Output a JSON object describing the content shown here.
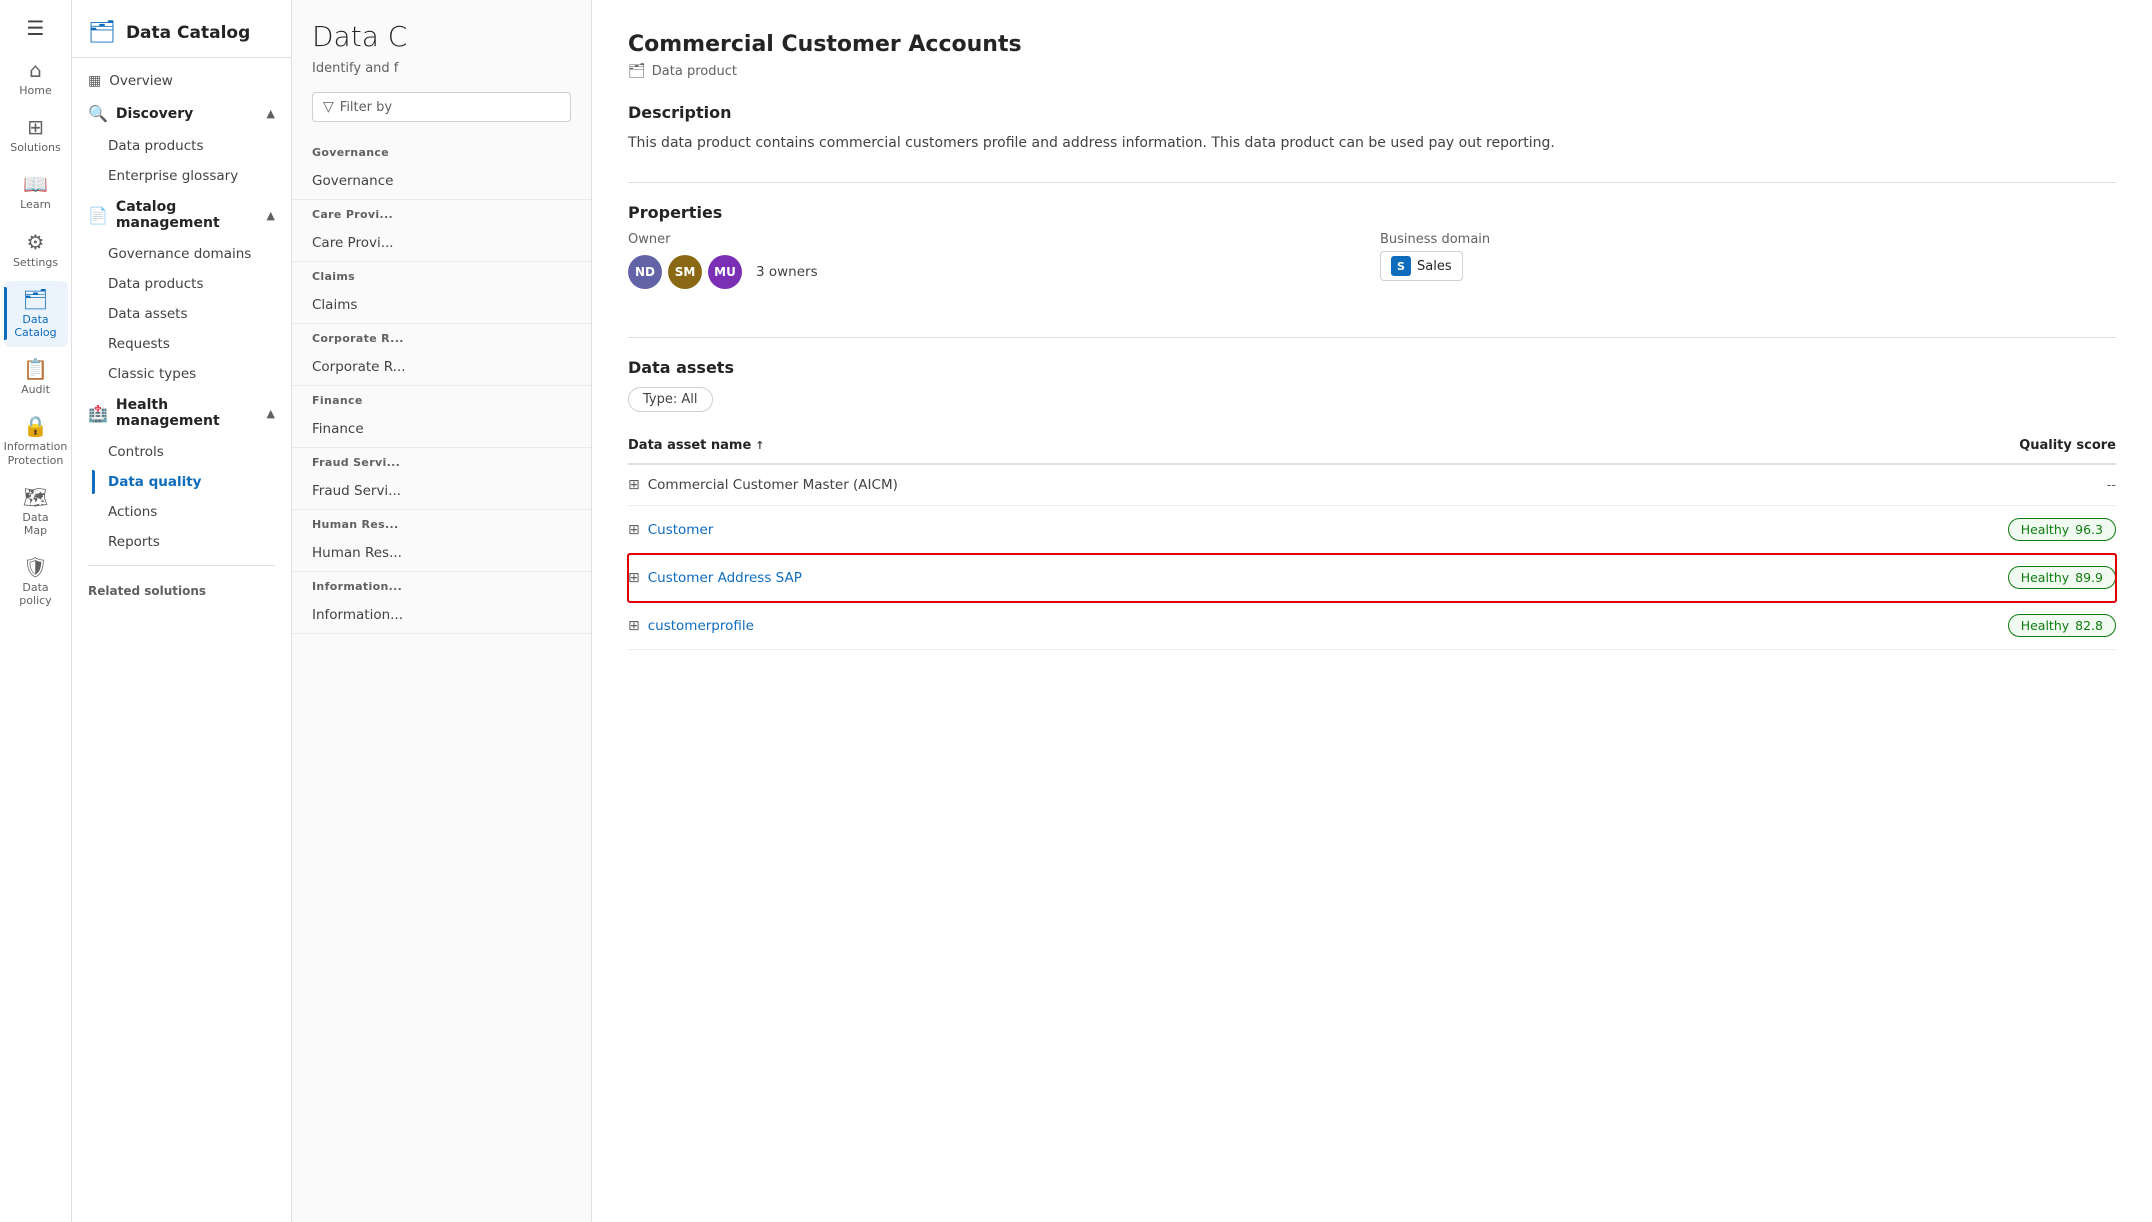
{
  "iconNav": {
    "items": [
      {
        "id": "home",
        "icon": "⌂",
        "label": "Home",
        "active": false
      },
      {
        "id": "solutions",
        "icon": "⊞",
        "label": "Solutions",
        "active": false
      },
      {
        "id": "learn",
        "icon": "📖",
        "label": "Learn",
        "active": false
      },
      {
        "id": "settings",
        "icon": "⚙",
        "label": "Settings",
        "active": false
      },
      {
        "id": "data-catalog",
        "icon": "🗂",
        "label": "Data Catalog",
        "active": true
      },
      {
        "id": "audit",
        "icon": "📋",
        "label": "Audit",
        "active": false
      },
      {
        "id": "information-protection",
        "icon": "🔒",
        "label": "Information Protection",
        "active": false
      },
      {
        "id": "data-map",
        "icon": "🗺",
        "label": "Data Map",
        "active": false
      },
      {
        "id": "data-policy",
        "icon": "🛡",
        "label": "Data policy",
        "active": false
      }
    ]
  },
  "sidebar": {
    "title": "Data Catalog",
    "overview": "Overview",
    "discoveryLabel": "Discovery",
    "discoveryItems": [
      {
        "id": "data-products-disc",
        "label": "Data products"
      },
      {
        "id": "enterprise-glossary",
        "label": "Enterprise glossary"
      }
    ],
    "catalogManagementLabel": "Catalog management",
    "catalogManagementItems": [
      {
        "id": "governance-domains",
        "label": "Governance domains"
      },
      {
        "id": "data-products-cat",
        "label": "Data products"
      },
      {
        "id": "data-assets",
        "label": "Data assets"
      },
      {
        "id": "requests",
        "label": "Requests"
      },
      {
        "id": "classic-types",
        "label": "Classic types"
      }
    ],
    "healthManagementLabel": "Health management",
    "healthManagementItems": [
      {
        "id": "controls",
        "label": "Controls"
      },
      {
        "id": "data-quality",
        "label": "Data quality",
        "active": true
      },
      {
        "id": "actions",
        "label": "Actions"
      },
      {
        "id": "reports",
        "label": "Reports"
      }
    ],
    "relatedSolutions": "Related solutions"
  },
  "listPanel": {
    "title": "Data C",
    "subtitle": "Identify and f",
    "filterPlaceholder": "Filter by",
    "groups": [
      {
        "label": "Governance",
        "items": []
      },
      {
        "label": "Care Provi",
        "items": []
      },
      {
        "label": "Claims",
        "items": []
      },
      {
        "label": "Corporate R",
        "items": []
      },
      {
        "label": "Finance",
        "items": []
      },
      {
        "label": "Fraud Servi",
        "items": []
      },
      {
        "label": "Human Res",
        "items": []
      },
      {
        "label": "Information",
        "items": []
      }
    ]
  },
  "detail": {
    "title": "Commercial Customer Accounts",
    "typeLabel": "Data product",
    "typeIcon": "🗂",
    "descriptionHeading": "Description",
    "descriptionText": "This data product contains commercial customers profile and address information. This data product can be used pay out reporting.",
    "propertiesHeading": "Properties",
    "ownerLabel": "Owner",
    "owners": [
      {
        "initials": "ND",
        "color": "#6264a7"
      },
      {
        "initials": "SM",
        "color": "#8b6914"
      },
      {
        "initials": "MU",
        "color": "#7b2fb5"
      }
    ],
    "ownersCount": "3 owners",
    "businessDomainLabel": "Business domain",
    "businessDomainLetter": "S",
    "businessDomainName": "Sales",
    "dataAssetsHeading": "Data assets",
    "typeFilterLabel": "Type: All",
    "columnName": "Data asset name",
    "columnQuality": "Quality score",
    "assets": [
      {
        "id": "commercial-customer-master",
        "icon": "⊞",
        "name": "Commercial Customer Master (AICM)",
        "isLink": false,
        "quality": "--",
        "isHealthy": false,
        "highlighted": false
      },
      {
        "id": "customer",
        "icon": "⊞",
        "name": "Customer",
        "isLink": true,
        "quality": "Healthy",
        "score": "96.3",
        "isHealthy": true,
        "highlighted": false
      },
      {
        "id": "customer-address-sap",
        "icon": "⊞",
        "name": "Customer Address SAP",
        "isLink": true,
        "quality": "Healthy",
        "score": "89.9",
        "isHealthy": true,
        "highlighted": true
      },
      {
        "id": "customerprofile",
        "icon": "⊞",
        "name": "customerprofile",
        "isLink": true,
        "quality": "Healthy",
        "score": "82.8",
        "isHealthy": true,
        "highlighted": false
      }
    ]
  }
}
